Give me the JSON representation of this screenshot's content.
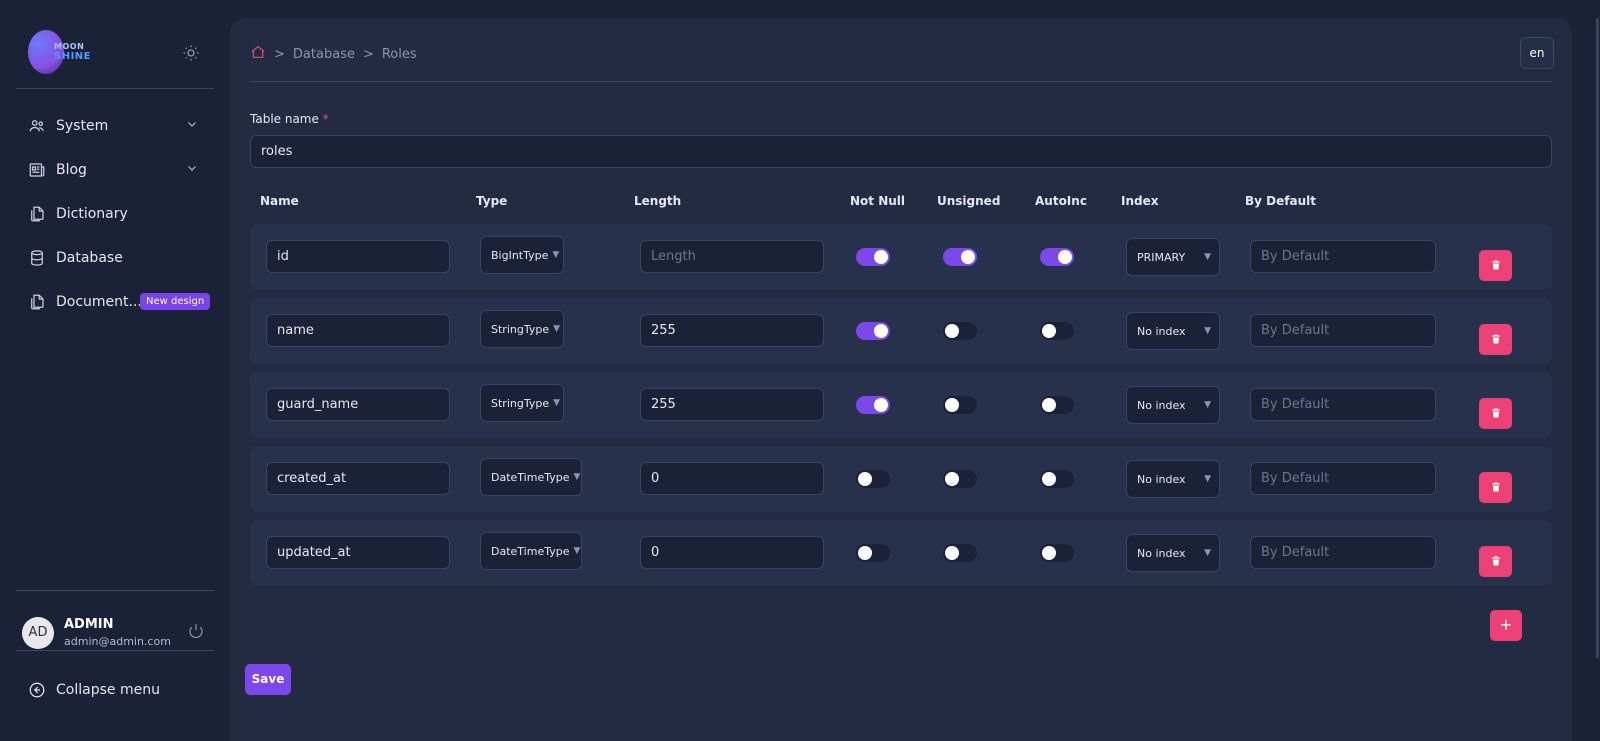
{
  "sidebar": {
    "logo": {
      "line1": "MOON",
      "line2": "SHINE"
    },
    "items": [
      {
        "label": "System",
        "icon": "users-icon",
        "has_chevron": true
      },
      {
        "label": "Blog",
        "icon": "newspaper-icon",
        "has_chevron": true
      },
      {
        "label": "Dictionary",
        "icon": "documents-icon",
        "has_chevron": false
      },
      {
        "label": "Database",
        "icon": "database-icon",
        "has_chevron": false
      },
      {
        "label": "Document...",
        "icon": "documents-icon",
        "has_chevron": false,
        "badge": "New design"
      }
    ],
    "user": {
      "initials": "AD",
      "name": "ADMIN",
      "email": "admin@admin.com"
    },
    "collapse_label": "Collapse menu"
  },
  "breadcrumb": {
    "items": [
      "Database",
      "Roles"
    ]
  },
  "lang": "en",
  "form": {
    "table_name_label": "Table name",
    "required_mark": "*",
    "table_name_value": "roles"
  },
  "columns": [
    "Name",
    "Type",
    "Length",
    "Not Null",
    "Unsigned",
    "AutoInc",
    "Index",
    "By Default"
  ],
  "rows": [
    {
      "name": "id",
      "type": "BigIntType",
      "length": "",
      "length_placeholder": "Length",
      "not_null": true,
      "unsigned": true,
      "autoinc": true,
      "index": "PRIMARY",
      "default_placeholder": "By Default"
    },
    {
      "name": "name",
      "type": "StringType",
      "length": "255",
      "length_placeholder": "Length",
      "not_null": true,
      "unsigned": false,
      "autoinc": false,
      "index": "No index",
      "default_placeholder": "By Default"
    },
    {
      "name": "guard_name",
      "type": "StringType",
      "length": "255",
      "length_placeholder": "Length",
      "not_null": true,
      "unsigned": false,
      "autoinc": false,
      "index": "No index",
      "default_placeholder": "By Default"
    },
    {
      "name": "created_at",
      "type": "DateTimeType",
      "length": "0",
      "length_placeholder": "Length",
      "not_null": false,
      "unsigned": false,
      "autoinc": false,
      "index": "No index",
      "default_placeholder": "By Default"
    },
    {
      "name": "updated_at",
      "type": "DateTimeType",
      "length": "0",
      "length_placeholder": "Length",
      "not_null": false,
      "unsigned": false,
      "autoinc": false,
      "index": "No index",
      "default_placeholder": "By Default"
    }
  ],
  "actions": {
    "add_label": "+",
    "save_label": "Save"
  },
  "colors": {
    "accent": "#7d48ea",
    "danger": "#ec4176",
    "background": "#1b2238",
    "panel": "#232b43"
  }
}
